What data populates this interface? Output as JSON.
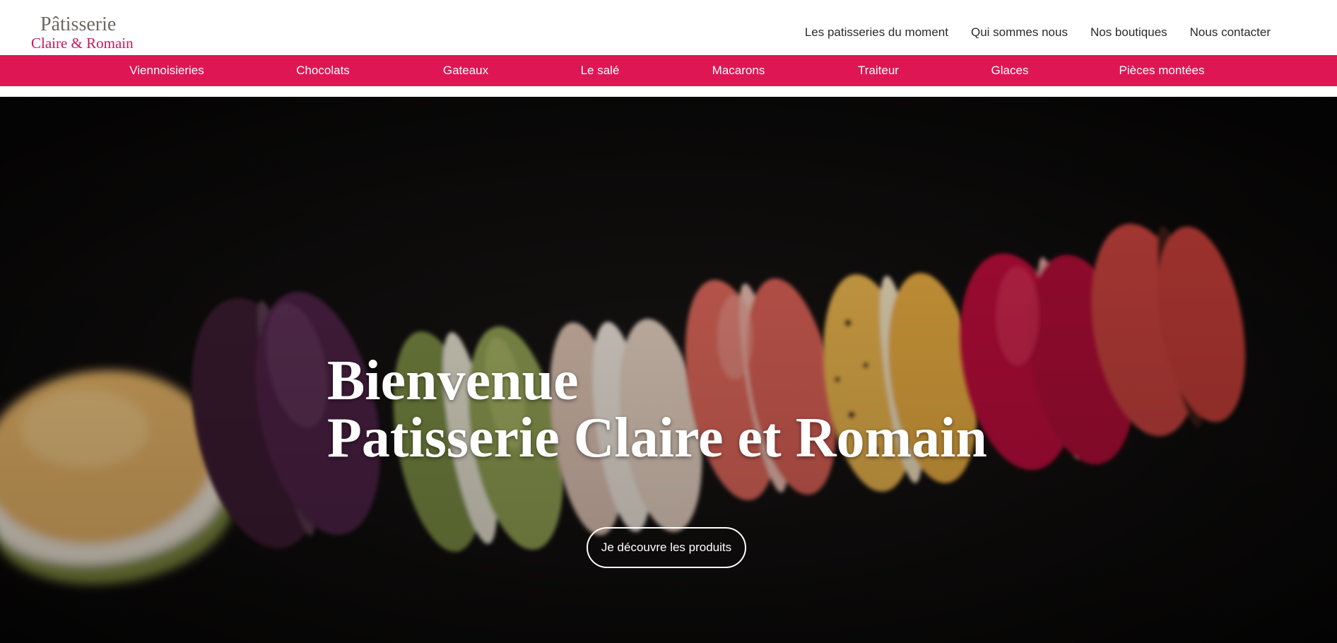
{
  "brand": {
    "logo_line1": "Pâtisserie",
    "logo_line2": "Claire & Romain",
    "accent_color": "#de1654"
  },
  "top_nav": [
    {
      "label": "Les patisseries du moment"
    },
    {
      "label": "Qui sommes nous"
    },
    {
      "label": "Nos boutiques"
    },
    {
      "label": "Nous contacter"
    }
  ],
  "categories": [
    {
      "label": "Viennoisieries"
    },
    {
      "label": "Chocolats"
    },
    {
      "label": "Gateaux"
    },
    {
      "label": "Le salé"
    },
    {
      "label": "Macarons"
    },
    {
      "label": "Traiteur"
    },
    {
      "label": "Glaces"
    },
    {
      "label": "Pièces montées"
    }
  ],
  "hero": {
    "title_line1": "Bienvenue",
    "title_line2": "Patisserie Claire et Romain",
    "button_label": "Je découvre les produits",
    "image": "macarons-row-photo"
  }
}
